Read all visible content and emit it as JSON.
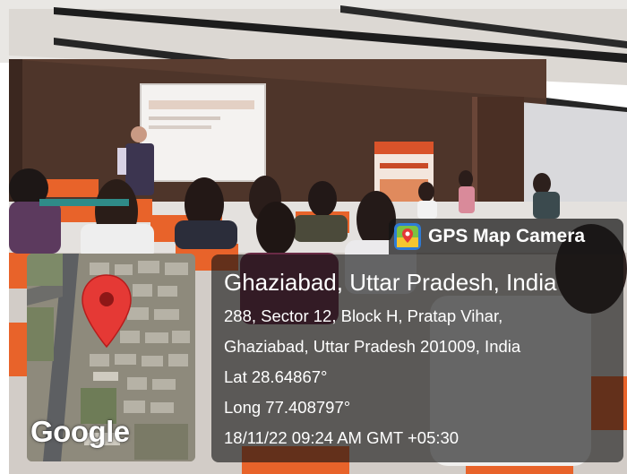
{
  "overlay": {
    "app_name": "GPS Map Camera",
    "location_title": "Ghaziabad, Uttar Pradesh, India",
    "address_line1": "288, Sector 12, Block H, Pratap Vihar,",
    "address_line2": "Ghaziabad, Uttar Pradesh 201009, India",
    "latitude": "Lat 28.64867°",
    "longitude": "Long 77.408797°",
    "timestamp": "18/11/22 09:24 AM GMT +05:30"
  },
  "map": {
    "provider_logo": "Google",
    "marker_icon": "map-pin-icon",
    "marker_color": "#e53935"
  },
  "colors": {
    "panel_bg": "#121212",
    "seat_orange": "#e8632a",
    "wall_wood": "#5a3d30"
  }
}
